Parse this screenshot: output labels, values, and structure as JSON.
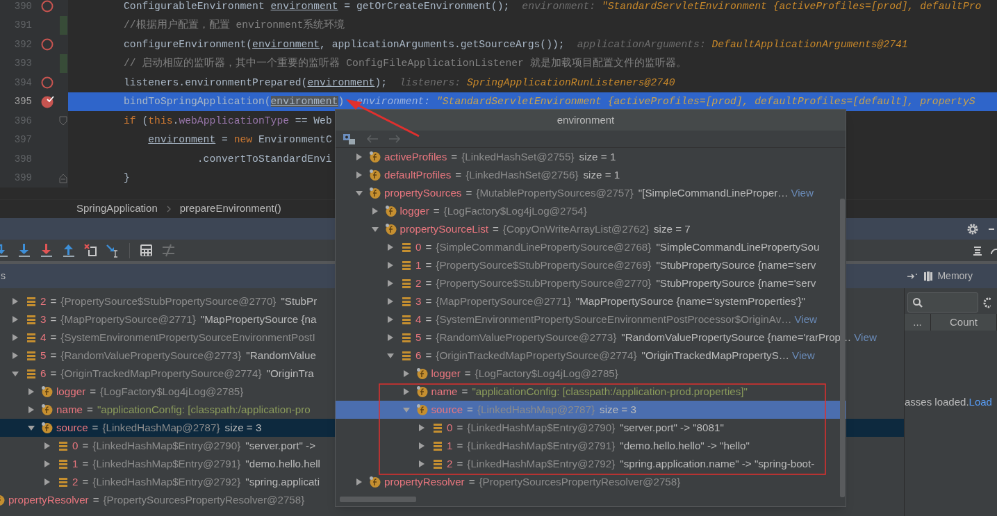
{
  "editor": {
    "lines": [
      {
        "number": "390",
        "breakpoint": true,
        "hit": false,
        "changed": false,
        "current": false,
        "fold_start": false,
        "fold_end": false,
        "tokens": [
          {
            "t": "ConfigurableEnvironment ",
            "kind": "plain"
          },
          {
            "t": "environment",
            "kind": "ref"
          },
          {
            "t": " = getOrCreateEnvironment();",
            "kind": "plain"
          }
        ],
        "hint": {
          "label": "environment:",
          "value": "\"StandardServletEnvironment {activeProfiles=[prod], defaultPro"
        }
      },
      {
        "number": "391",
        "breakpoint": false,
        "changed": true,
        "current": false,
        "fold_start": false,
        "fold_end": false,
        "tokens": [
          {
            "t": "//根据用户配置，配置 environment系统环境",
            "kind": "comment"
          }
        ]
      },
      {
        "number": "392",
        "breakpoint": true,
        "hit": false,
        "changed": false,
        "current": false,
        "fold_start": false,
        "fold_end": false,
        "tokens": [
          {
            "t": "configureEnvironment(",
            "kind": "plain"
          },
          {
            "t": "environment",
            "kind": "ref"
          },
          {
            "t": ", applicationArguments.getSourceArgs());",
            "kind": "plain"
          }
        ],
        "hint": {
          "label": "applicationArguments:",
          "value": "DefaultApplicationArguments@2741"
        }
      },
      {
        "number": "393",
        "breakpoint": false,
        "changed": true,
        "current": false,
        "fold_start": false,
        "fold_end": false,
        "tokens": [
          {
            "t": "// 启动相应的监听器，其中一个重要的监听器 ConfigFileApplicationListener 就是加载项目配置文件的监听器。",
            "kind": "comment"
          }
        ]
      },
      {
        "number": "394",
        "breakpoint": true,
        "hit": false,
        "changed": false,
        "current": false,
        "fold_start": false,
        "fold_end": false,
        "tokens": [
          {
            "t": "listeners.environmentPrepared(",
            "kind": "plain"
          },
          {
            "t": "environment",
            "kind": "ref"
          },
          {
            "t": ");",
            "kind": "plain"
          }
        ],
        "hint": {
          "label": "listeners:",
          "value": "SpringApplicationRunListeners@2740"
        }
      },
      {
        "number": "395",
        "breakpoint": true,
        "hit": true,
        "changed": false,
        "current": true,
        "fold_start": false,
        "fold_end": false,
        "tokens": [
          {
            "t": "bindToSpringApplication(",
            "kind": "plain"
          },
          {
            "t": "environment",
            "kind": "marked"
          },
          {
            "t": ")",
            "kind": "plain"
          }
        ],
        "hint": {
          "label": "environment:",
          "value": "\"StandardServletEnvironment {activeProfiles=[prod], defaultProfiles=[default], propertyS"
        }
      },
      {
        "number": "396",
        "breakpoint": false,
        "changed": false,
        "current": false,
        "fold_start": true,
        "fold_end": false,
        "tokens": [
          {
            "t": "if",
            "kind": "keyword"
          },
          {
            "t": " (",
            "kind": "plain"
          },
          {
            "t": "this",
            "kind": "keyword"
          },
          {
            "t": ".",
            "kind": "plain"
          },
          {
            "t": "webApplicationType",
            "kind": "field"
          },
          {
            "t": " == Web",
            "kind": "plain"
          }
        ]
      },
      {
        "number": "397",
        "breakpoint": false,
        "changed": false,
        "current": false,
        "fold_start": false,
        "fold_end": false,
        "tokens": [
          {
            "t": "    environment",
            "kind": "ref"
          },
          {
            "t": " = ",
            "kind": "plain"
          },
          {
            "t": "new",
            "kind": "keyword"
          },
          {
            "t": " EnvironmentC",
            "kind": "plain"
          }
        ]
      },
      {
        "number": "398",
        "breakpoint": false,
        "changed": false,
        "current": false,
        "fold_start": false,
        "fold_end": false,
        "tokens": [
          {
            "t": "            .convertToStandardEnvi",
            "kind": "plain"
          }
        ]
      },
      {
        "number": "399",
        "breakpoint": false,
        "changed": false,
        "current": false,
        "fold_start": false,
        "fold_end": true,
        "tokens": [
          {
            "t": "}",
            "kind": "plain"
          }
        ]
      }
    ]
  },
  "breadcrumb": [
    "SpringApplication",
    "prepareEnvironment()"
  ],
  "toolbar": [
    {
      "kind": "step-over",
      "disabled": false
    },
    {
      "kind": "step-into",
      "disabled": false
    },
    {
      "kind": "force-step-into",
      "disabled": false
    },
    {
      "kind": "step-out",
      "disabled": false
    },
    {
      "kind": "drop-frame",
      "disabled": false
    },
    {
      "kind": "run-to-cursor",
      "disabled": false
    },
    {
      "kind": "evaluate",
      "disabled": false
    },
    {
      "kind": "trace",
      "disabled": true
    }
  ],
  "variables": {
    "title": "s",
    "tree": [
      {
        "kind": "element",
        "label": "2",
        "eq": "=",
        "type": "{PropertySource$StubPropertySource@2770}",
        "detail": "\"StubPr",
        "expanded": false,
        "selected": false
      },
      {
        "kind": "element",
        "label": "3",
        "eq": "=",
        "type": "{MapPropertySource@2771}",
        "detail": "\"MapPropertySource {na",
        "expanded": false,
        "selected": false
      },
      {
        "kind": "element",
        "label": "4",
        "eq": "=",
        "type": "{SystemEnvironmentPropertySourceEnvironmentPostI",
        "expanded": false,
        "selected": false
      },
      {
        "kind": "element",
        "label": "5",
        "eq": "=",
        "type": "{RandomValuePropertySource@2773}",
        "detail": "\"RandomValue",
        "expanded": false,
        "selected": false
      },
      {
        "kind": "element",
        "label": "6",
        "eq": "=",
        "type": "{OriginTrackedMapPropertySource@2774}",
        "detail": "\"OriginTra",
        "expanded": true,
        "selected": false,
        "children": [
          {
            "kind": "field",
            "label": "logger",
            "eq": "=",
            "type": "{LogFactory$Log4jLog@2785}",
            "expanded": false,
            "selected": false
          },
          {
            "kind": "field",
            "label": "name",
            "eq": "=",
            "string": "\"applicationConfig: [classpath:/application-pro",
            "expanded": false,
            "selected": false
          },
          {
            "kind": "field",
            "label": "source",
            "eq": "=",
            "type": "{LinkedHashMap@2787}",
            "detail": "size = 3",
            "expanded": true,
            "selected": true,
            "children": [
              {
                "kind": "element",
                "label": "0",
                "eq": "=",
                "type": "{LinkedHashMap$Entry@2790}",
                "detail": "\"server.port\" ->",
                "expanded": false,
                "selected": false
              },
              {
                "kind": "element",
                "label": "1",
                "eq": "=",
                "type": "{LinkedHashMap$Entry@2791}",
                "detail": "\"demo.hello.hell",
                "expanded": false,
                "selected": false
              },
              {
                "kind": "element",
                "label": "2",
                "eq": "=",
                "type": "{LinkedHashMap$Entry@2792}",
                "detail": "\"spring.applicati",
                "expanded": false,
                "selected": false
              }
            ]
          }
        ]
      }
    ],
    "trailing": [
      {
        "kind": "field",
        "label": "propertyResolver",
        "eq": "=",
        "type": "{PropertySourcesPropertyResolver@2758}",
        "expanded": false,
        "selected": false
      }
    ]
  },
  "memory": {
    "title": "Memory",
    "columns": [
      "...",
      "Count"
    ],
    "status": "asses loaded.",
    "link": "Load"
  },
  "popup": {
    "title": "environment",
    "tree": [
      {
        "kind": "field",
        "label": "activeProfiles",
        "eq": "=",
        "type": "{LinkedHashSet@2755}",
        "detail": "size = 1",
        "expanded": false,
        "selected": false
      },
      {
        "kind": "field",
        "label": "defaultProfiles",
        "eq": "=",
        "type": "{LinkedHashSet@2756}",
        "detail": "size = 1",
        "expanded": false,
        "selected": false
      },
      {
        "kind": "field",
        "label": "propertySources",
        "eq": "=",
        "type": "{MutablePropertySources@2757}",
        "detail": "\"[SimpleCommandLineProper…",
        "view": "View",
        "expanded": true,
        "selected": false,
        "children": [
          {
            "kind": "field",
            "label": "logger",
            "eq": "=",
            "type": "{LogFactory$Log4jLog@2754}",
            "expanded": false,
            "selected": false
          },
          {
            "kind": "field",
            "label": "propertySourceList",
            "eq": "=",
            "type": "{CopyOnWriteArrayList@2762}",
            "detail": "size = 7",
            "expanded": true,
            "selected": false,
            "children": [
              {
                "kind": "element",
                "label": "0",
                "eq": "=",
                "type": "{SimpleCommandLinePropertySource@2768}",
                "detail": "\"SimpleCommandLinePropertySou",
                "expanded": false,
                "selected": false
              },
              {
                "kind": "element",
                "label": "1",
                "eq": "=",
                "type": "{PropertySource$StubPropertySource@2769}",
                "detail": "\"StubPropertySource {name='serv",
                "expanded": false,
                "selected": false
              },
              {
                "kind": "element",
                "label": "2",
                "eq": "=",
                "type": "{PropertySource$StubPropertySource@2770}",
                "detail": "\"StubPropertySource {name='serv",
                "expanded": false,
                "selected": false
              },
              {
                "kind": "element",
                "label": "3",
                "eq": "=",
                "type": "{MapPropertySource@2771}",
                "detail": "\"MapPropertySource {name='systemProperties'}\"",
                "expanded": false,
                "selected": false
              },
              {
                "kind": "element",
                "label": "4",
                "eq": "=",
                "type": "{SystemEnvironmentPropertySourceEnvironmentPostProcessor$OriginAv…",
                "view": "View",
                "expanded": false,
                "selected": false
              },
              {
                "kind": "element",
                "label": "5",
                "eq": "=",
                "type": "{RandomValuePropertySource@2773}",
                "detail": "\"RandomValuePropertySource {name='rarProp…",
                "view": "View",
                "expanded": false,
                "selected": false
              },
              {
                "kind": "element",
                "label": "6",
                "eq": "=",
                "type": "{OriginTrackedMapPropertySource@2774}",
                "detail": "\"OriginTrackedMapPropertyS…",
                "view": "View",
                "expanded": true,
                "selected": false,
                "children": [
                  {
                    "kind": "field",
                    "label": "logger",
                    "eq": "=",
                    "type": "{LogFactory$Log4jLog@2785}",
                    "expanded": false,
                    "selected": false
                  },
                  {
                    "kind": "field",
                    "label": "name",
                    "eq": "=",
                    "string": "\"applicationConfig: [classpath:/application-prod.properties]\"",
                    "expanded": false,
                    "selected": false
                  },
                  {
                    "kind": "field",
                    "label": "source",
                    "eq": "=",
                    "type": "{LinkedHashMap@2787}",
                    "detail": "size = 3",
                    "expanded": true,
                    "selected": true,
                    "children": [
                      {
                        "kind": "element",
                        "label": "0",
                        "eq": "=",
                        "type": "{LinkedHashMap$Entry@2790}",
                        "detail": "\"server.port\" -> \"8081\"",
                        "expanded": false,
                        "selected": false
                      },
                      {
                        "kind": "element",
                        "label": "1",
                        "eq": "=",
                        "type": "{LinkedHashMap$Entry@2791}",
                        "detail": "\"demo.hello.hello\" -> \"hello\"",
                        "expanded": false,
                        "selected": false
                      },
                      {
                        "kind": "element",
                        "label": "2",
                        "eq": "=",
                        "type": "{LinkedHashMap$Entry@2792}",
                        "detail": "\"spring.application.name\" -> \"spring-boot-",
                        "expanded": false,
                        "selected": false
                      }
                    ]
                  }
                ]
              }
            ]
          }
        ]
      },
      {
        "kind": "field",
        "label": "propertyResolver",
        "eq": "=",
        "type": "{PropertySourcesPropertyResolver@2758}",
        "expanded": false,
        "selected": false
      }
    ]
  }
}
